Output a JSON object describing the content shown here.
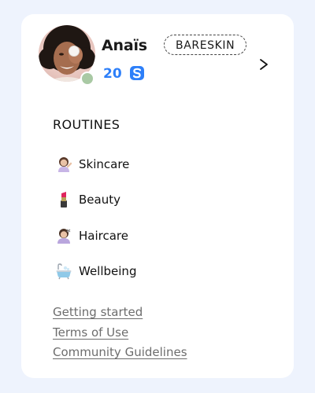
{
  "profile": {
    "name": "Anaïs",
    "badge": "BARESKIN",
    "points": "20",
    "status_color": "#a9c9a4"
  },
  "routines": {
    "title": "ROUTINES",
    "items": [
      {
        "label": "Skincare",
        "icon": "woman-tipping-hand-emoji"
      },
      {
        "label": "Beauty",
        "icon": "lipstick-emoji"
      },
      {
        "label": "Haircare",
        "icon": "person-getting-haircut-emoji"
      },
      {
        "label": "Wellbeing",
        "icon": "bathtub-emoji"
      }
    ]
  },
  "links": {
    "getting_started": "Getting started",
    "terms": "Terms of Use",
    "guidelines": "Community Guidelines"
  },
  "colors": {
    "accent": "#2d7ff9",
    "page_bg": "#eef3fd",
    "card_bg": "#ffffff",
    "link": "#6d6d6d"
  }
}
